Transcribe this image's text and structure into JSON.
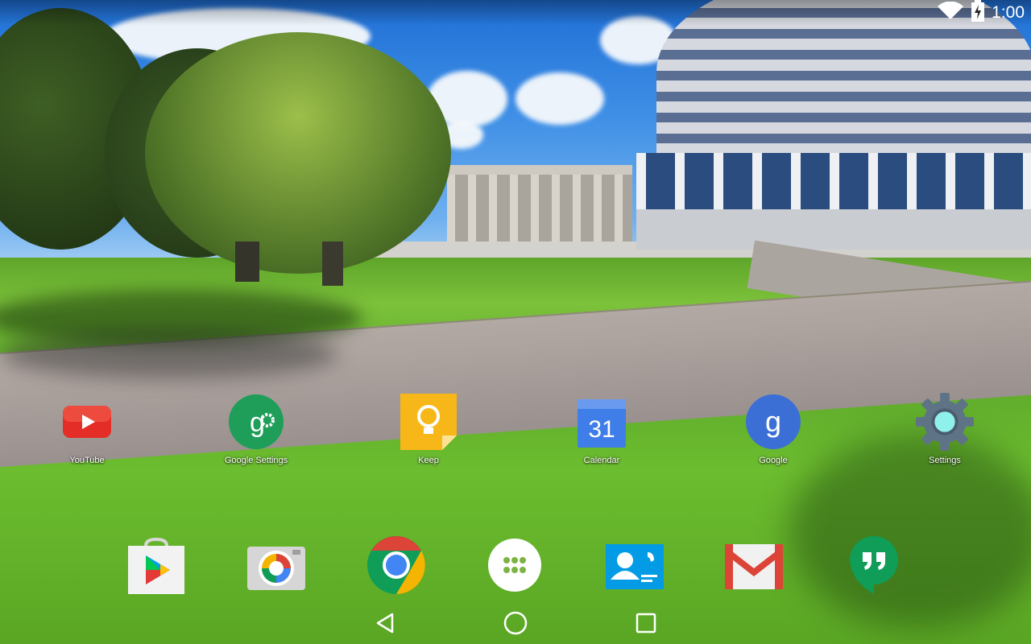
{
  "status_bar": {
    "time": "1:00",
    "wifi_icon": "wifi-icon",
    "battery_icon": "battery-charging-icon"
  },
  "apps": [
    {
      "label": "YouTube",
      "icon": "youtube-icon"
    },
    {
      "label": "Google Settings",
      "icon": "google-settings-icon"
    },
    {
      "label": "Keep",
      "icon": "keep-icon"
    },
    {
      "label": "Calendar",
      "icon": "calendar-icon",
      "badge": "31"
    },
    {
      "label": "Google",
      "icon": "google-icon"
    },
    {
      "label": "Settings",
      "icon": "settings-gear-icon"
    }
  ],
  "dock": [
    {
      "icon": "play-store-icon"
    },
    {
      "icon": "camera-icon"
    },
    {
      "icon": "chrome-icon"
    },
    {
      "icon": "app-drawer-icon"
    },
    {
      "icon": "contacts-icon"
    },
    {
      "icon": "gmail-icon"
    },
    {
      "icon": "hangouts-icon"
    }
  ],
  "nav": {
    "back": "back-icon",
    "home": "home-icon",
    "recents": "recents-icon"
  },
  "colors": {
    "youtube": "#e52d27",
    "google_green": "#1e9e58",
    "keep_yellow": "#f7b718",
    "calendar_blue": "#3f7de8",
    "google_blue": "#3c6fd6",
    "gmail_red": "#db4437",
    "hangouts": "#0f9d58"
  }
}
